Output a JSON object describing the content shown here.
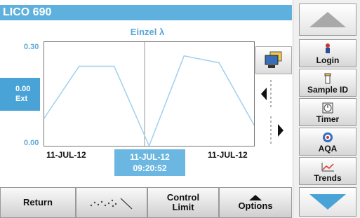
{
  "header": {
    "title": "LICO 690"
  },
  "chart": {
    "title": "Einzel λ",
    "y_top_label": "0.30",
    "y_bottom_label": "0.00",
    "readout_value": "0.00",
    "readout_unit": "Ext",
    "x_labels": [
      "11-JUL-12",
      "11-JUL-12"
    ],
    "selected_date": "11-JUL-12",
    "selected_time": "09:20:52"
  },
  "chart_data": {
    "type": "line",
    "x": [
      0,
      1,
      2,
      3,
      4,
      5,
      6
    ],
    "values": [
      0.08,
      0.23,
      0.23,
      0.0,
      0.26,
      0.24,
      0.06
    ],
    "ylim": [
      0,
      0.3
    ],
    "y_ticks": [
      "0.30",
      "0.00"
    ],
    "grid": false,
    "color": "#9fd0ee"
  },
  "bottom_bar": {
    "return_label": "Return",
    "control_limit_label_1": "Control",
    "control_limit_label_2": "Limit",
    "options_label": "Options"
  },
  "right_panel": {
    "login_label": "Login",
    "sample_id_label": "Sample ID",
    "timer_label": "Timer",
    "aqa_label": "AQA",
    "trends_label": "Trends"
  },
  "colors": {
    "accent": "#5fb1dd",
    "line": "#9fd0ee",
    "readout": "#4aa3d7"
  },
  "icons": [
    "monitor-icon",
    "chevron-left-icon",
    "chevron-right-icon",
    "scatter-icon",
    "triangle-up-icon",
    "person-icon",
    "vial-icon",
    "clock-icon",
    "globe-icon",
    "chart-icon",
    "arrow-up-icon",
    "arrow-down-icon"
  ]
}
